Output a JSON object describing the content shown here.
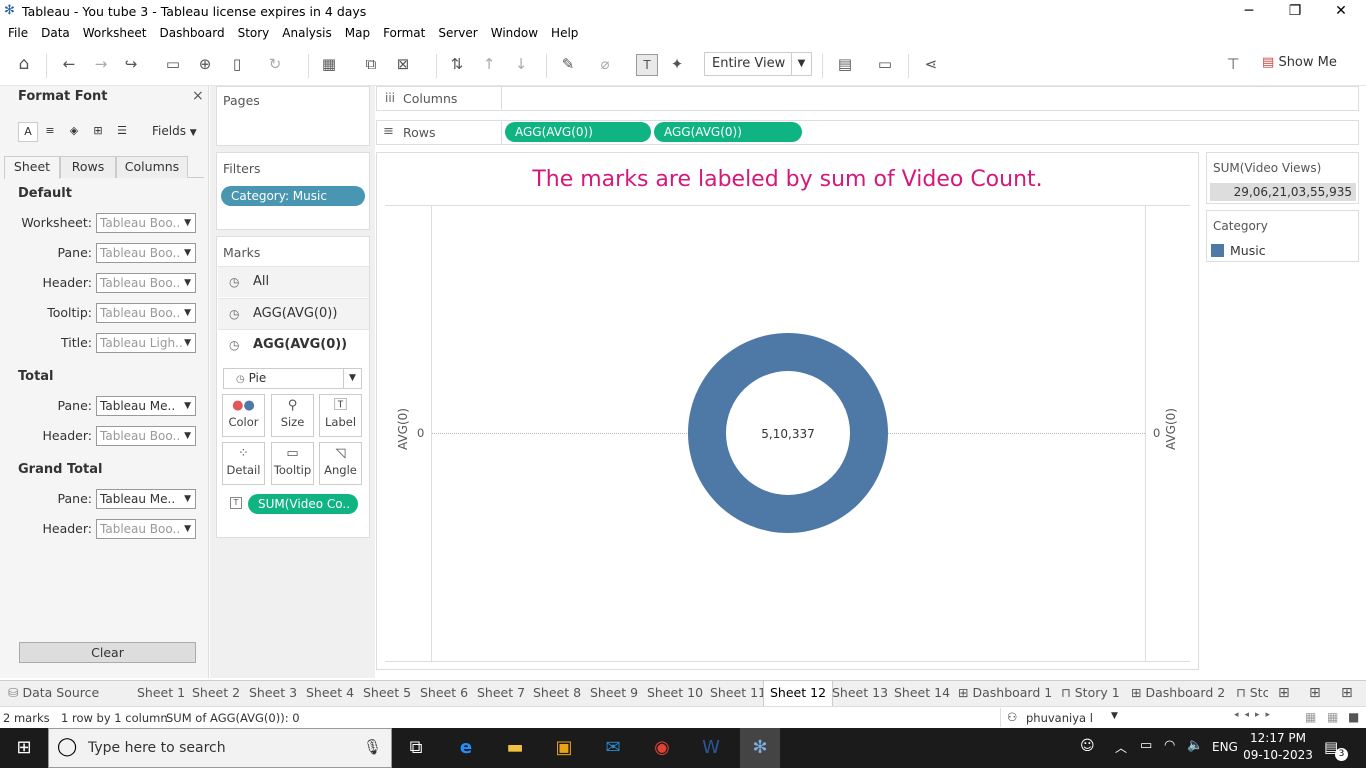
{
  "window": {
    "title": "Tableau - You tube 3 - Tableau license expires in 4 days"
  },
  "menu": [
    "File",
    "Data",
    "Worksheet",
    "Dashboard",
    "Story",
    "Analysis",
    "Map",
    "Format",
    "Server",
    "Window",
    "Help"
  ],
  "toolbar": {
    "view_mode": "Entire View",
    "show_me": "Show Me"
  },
  "format_pane": {
    "title": "Format Font",
    "fields_label": "Fields",
    "tabs": [
      "Sheet",
      "Rows",
      "Columns"
    ],
    "sections": {
      "default": "Default",
      "total": "Total",
      "grand_total": "Grand Total"
    },
    "default_rows": [
      {
        "label": "Worksheet:",
        "value": "Tableau Boo.."
      },
      {
        "label": "Pane:",
        "value": "Tableau Boo.."
      },
      {
        "label": "Header:",
        "value": "Tableau Boo.."
      },
      {
        "label": "Tooltip:",
        "value": "Tableau Boo.."
      },
      {
        "label": "Title:",
        "value": "Tableau Ligh.."
      }
    ],
    "total_rows": [
      {
        "label": "Pane:",
        "value": "Tableau Me.."
      },
      {
        "label": "Header:",
        "value": "Tableau Boo.."
      }
    ],
    "grand_total_rows": [
      {
        "label": "Pane:",
        "value": "Tableau Me.."
      },
      {
        "label": "Header:",
        "value": "Tableau Boo.."
      }
    ],
    "clear_label": "Clear"
  },
  "pages": {
    "title": "Pages"
  },
  "filters": {
    "title": "Filters",
    "items": [
      "Category: Music"
    ]
  },
  "marks": {
    "title": "Marks",
    "rows": [
      "All",
      "AGG(AVG(0))",
      "AGG(AVG(0))"
    ],
    "mark_type": "Pie",
    "buttons": [
      "Color",
      "Size",
      "Label",
      "Detail",
      "Tooltip",
      "Angle"
    ],
    "label_pill": "SUM(Video Co.."
  },
  "shelves": {
    "columns_label": "Columns",
    "rows_label": "Rows",
    "rows_pills": [
      "AGG(AVG(0))",
      "AGG(AVG(0))"
    ]
  },
  "view": {
    "title": "The marks are labeled by sum of Video Count.",
    "left_axis_title": "AVG(0)",
    "right_axis_title": "AVG(0)",
    "left_tick": "0",
    "right_tick": "0",
    "center_label": "5,10,337",
    "donut_color": "#4e79a7"
  },
  "chart_data": {
    "type": "pie",
    "categories": [
      "Music"
    ],
    "values": [
      510337
    ],
    "labels": [
      "5,10,337"
    ],
    "colors": [
      "#4e79a7"
    ]
  },
  "legend": {
    "sum_title": "SUM(Video Views)",
    "sum_value": "29,06,21,03,55,935",
    "category_title": "Category",
    "category_items": [
      {
        "name": "Music",
        "color": "#4e79a7"
      }
    ]
  },
  "sheet_tabs": {
    "data_source": "Data Source",
    "tabs": [
      "Sheet 1",
      "Sheet 2",
      "Sheet 3",
      "Sheet 4",
      "Sheet 5",
      "Sheet 6",
      "Sheet 7",
      "Sheet 8",
      "Sheet 9",
      "Sheet 10",
      "Sheet 11",
      "Sheet 12",
      "Sheet 13",
      "Sheet 14",
      "Dashboard 1",
      "Story 1",
      "Dashboard 2",
      "Stc"
    ],
    "active": "Sheet 12"
  },
  "status": {
    "marks": "2 marks",
    "rows_cols": "1 row by 1 column",
    "sum": "SUM of AGG(AVG(0)): 0",
    "user": "phuvaniya l"
  },
  "taskbar": {
    "search_placeholder": "Type here to search",
    "time": "12:17 PM",
    "date": "09-10-2023",
    "lang": "ENG",
    "notif_count": "3"
  }
}
